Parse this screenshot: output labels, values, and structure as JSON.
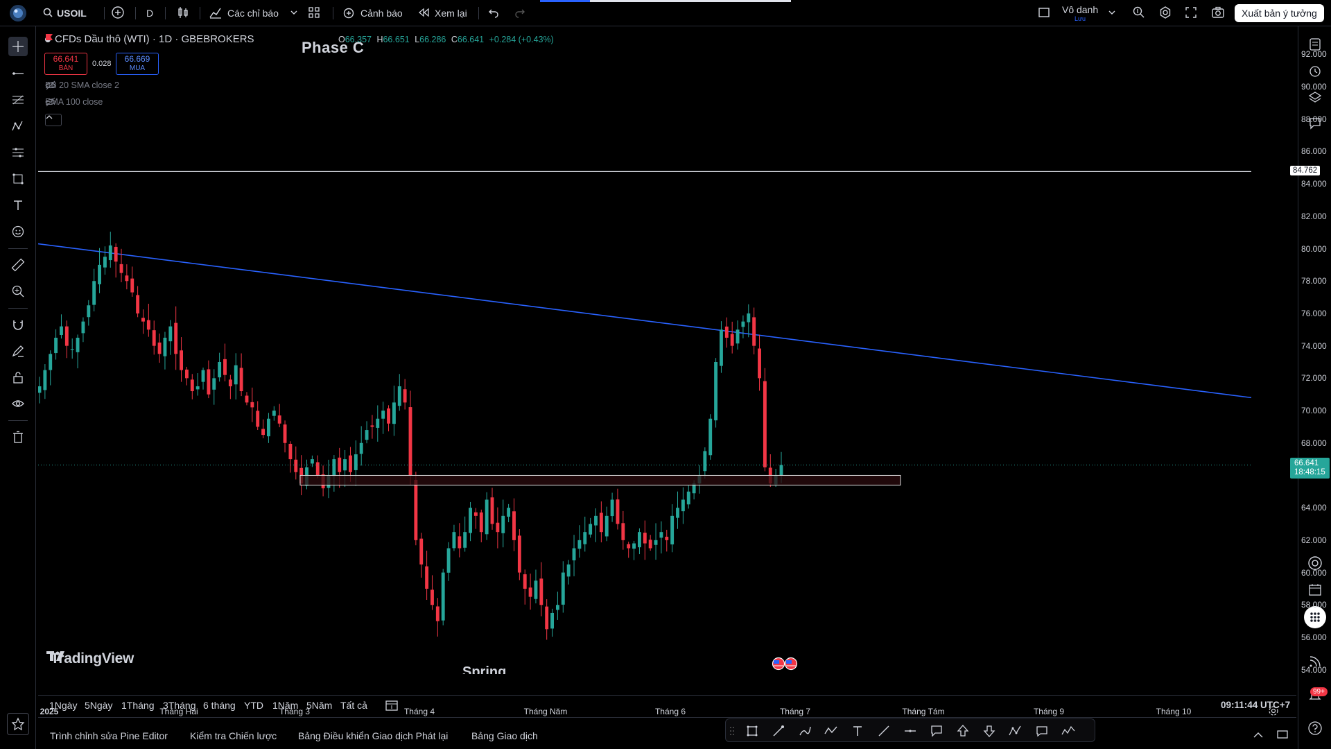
{
  "topbar": {
    "symbol": "USOIL",
    "interval": "D",
    "indicators_label": "Các chỉ báo",
    "alert_label": "Cảnh báo",
    "replay_label": "Xem lại",
    "layout_name": "Vô danh",
    "layout_sub": "Lưu",
    "publish_label": "Xuất bản ý tưởng"
  },
  "legend": {
    "title": "CFDs Dầu thô (WTI) · 1D · GBEBROKERS",
    "o_key": "O",
    "o": "66.357",
    "h_key": "H",
    "h": "66.651",
    "l_key": "L",
    "l": "66.286",
    "c_key": "C",
    "c": "66.641",
    "change": "+0.284 (+0.43%)",
    "sell_price": "66.641",
    "sell_label": "BÁN",
    "spread": "0.028",
    "buy_price": "66.669",
    "buy_label": "MUA",
    "indicator1": "BB 20 SMA close 2",
    "indicator2": "EMA 100 close"
  },
  "annotations": {
    "phase": "Phase C",
    "spring": "Spring"
  },
  "brand": "TradingView",
  "price_axis": {
    "labels": [
      "92.000",
      "90.000",
      "88.000",
      "86.000",
      "84.000",
      "82.000",
      "80.000",
      "78.000",
      "76.000",
      "74.000",
      "72.000",
      "70.000",
      "68.000",
      "66.000",
      "64.000",
      "62.000",
      "60.000",
      "58.000",
      "56.000",
      "54.000"
    ],
    "horizontal_line_price": "84.762",
    "last_price": "66.641",
    "countdown": "18:48:15"
  },
  "time_axis": {
    "labels": [
      "2025",
      "Tháng Hai",
      "Tháng 3",
      "Tháng 4",
      "Tháng Năm",
      "Tháng 6",
      "Tháng 7",
      "Tháng Tám",
      "Tháng 9",
      "Tháng 10"
    ]
  },
  "range_bar": {
    "ranges": [
      "1Ngày",
      "5Ngày",
      "1Tháng",
      "3Tháng",
      "6 tháng",
      "YTD",
      "1Năm",
      "5Năm",
      "Tất cả"
    ],
    "clock": "09:11:44 UTC+7"
  },
  "bottom_tabs": [
    "Trình chỉnh sửa Pine Editor",
    "Kiểm tra Chiến lược",
    "Bảng Điều khiển Giao dịch Phát lại",
    "Bảng Giao dịch"
  ],
  "notifications_badge": "99+",
  "colors": {
    "up": "#26a69a",
    "down": "#f23645",
    "trendline": "#2962ff",
    "background": "#000000",
    "zone_border": "#e0e0e0",
    "zone_fill": "#2b0b0e"
  },
  "chart_data": {
    "type": "candlestick",
    "title": "CFDs Dầu thô (WTI) · 1D · GBEBROKERS",
    "x_ticks": [
      "2025",
      "Tháng Hai",
      "Tháng 3",
      "Tháng 4",
      "Tháng Năm",
      "Tháng 6",
      "Tháng 7",
      "Tháng Tám",
      "Tháng 9",
      "Tháng 10"
    ],
    "ylim": [
      53.5,
      93
    ],
    "y_ticks": [
      92,
      90,
      88,
      86,
      84,
      82,
      80,
      78,
      76,
      74,
      72,
      70,
      68,
      66,
      64,
      62,
      60,
      58,
      56,
      54
    ],
    "close_path": [
      71.5,
      72.5,
      73.5,
      74.5,
      75.2,
      74.0,
      73.8,
      74.5,
      75.5,
      76.5,
      78.0,
      79.0,
      79.5,
      80.2,
      79.2,
      78.5,
      78.0,
      77.3,
      76.0,
      75.5,
      75.0,
      74.0,
      73.5,
      74.5,
      75.2,
      73.5,
      72.5,
      72.0,
      71.2,
      71.5,
      72.5,
      71.0,
      72.0,
      73.0,
      72.2,
      71.5,
      72.8,
      71.2,
      70.5,
      70.2,
      69.0,
      68.5,
      69.5,
      70.0,
      69.2,
      68.0,
      67.0,
      66.2,
      65.5,
      66.5,
      67.0,
      66.0,
      65.2,
      66.0,
      67.0,
      66.2,
      67.0,
      66.2,
      67.3,
      68.0,
      68.8,
      69.0,
      69.5,
      70.0,
      69.2,
      70.5,
      71.5,
      70.5,
      66.0,
      62.0,
      60.5,
      59.0,
      58.0,
      57.0,
      60.0,
      61.5,
      62.5,
      61.5,
      62.5,
      64.0,
      63.5,
      62.5,
      64.5,
      63.0,
      62.5,
      63.5,
      64.0,
      62.0,
      60.0,
      59.0,
      58.5,
      59.5,
      58.0,
      56.5,
      57.5,
      58.0,
      60.0,
      60.5,
      61.5,
      62.0,
      62.5,
      63.0,
      63.5,
      62.5,
      63.5,
      64.5,
      63.0,
      62.0,
      61.5,
      61.8,
      62.5,
      61.8,
      61.5,
      62.0,
      62.5,
      62.0,
      63.5,
      64.0,
      64.5,
      65.0,
      65.5,
      66.0,
      67.5,
      69.5,
      73.0,
      75.0,
      74.5,
      74.0,
      75.0,
      75.5,
      76.0,
      74.0,
      72.0,
      66.5,
      65.5,
      66.0,
      66.641
    ],
    "horizontal_line": 84.762,
    "trendline": {
      "from": {
        "x": "2025",
        "y": 80.3
      },
      "to": {
        "x": "Tháng 9",
        "y": 70.8
      }
    },
    "support_zone": {
      "low": 65.4,
      "high": 66.0
    },
    "last_price": 66.641
  }
}
